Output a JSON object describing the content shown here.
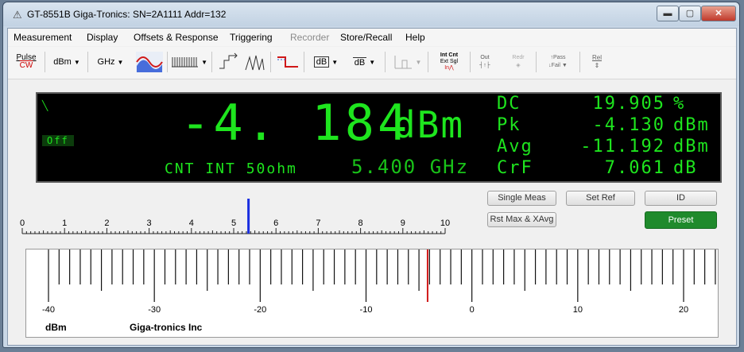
{
  "window": {
    "title": "GT-8551B Giga-Tronics: SN=2A1111  Addr=132",
    "min_glyph": "▬",
    "max_glyph": "▢",
    "close_glyph": "✕"
  },
  "menu": [
    {
      "label": "Measurement",
      "enabled": true
    },
    {
      "label": "Display",
      "enabled": true
    },
    {
      "label": "Offsets & Response",
      "enabled": true
    },
    {
      "label": "Triggering",
      "enabled": true
    },
    {
      "label": "Recorder",
      "enabled": false
    },
    {
      "label": "Store/Recall",
      "enabled": true
    },
    {
      "label": "Help",
      "enabled": true
    }
  ],
  "toolbar": {
    "pulse_label": "Pulse",
    "cw_label": "CW",
    "units_label": "dBm",
    "freq_label": "GHz",
    "dB_label": "dB",
    "int_label": "Int",
    "cnt_label": "Cnt",
    "ext_label": "Ext",
    "sgl_label": "Sgl",
    "in_label": "In",
    "out_label": "Out",
    "redr_label": "Redr",
    "pass_label": "Pass",
    "fail_label": "Fail",
    "rel_label": "Rel"
  },
  "readout": {
    "main_value": "-4. 184",
    "main_unit": "dBm",
    "off_label": "Off",
    "mode_line": "CNT INT 50ohm",
    "frequency": "5.400 GHz",
    "stats": [
      {
        "label": "DC",
        "value": "19.905",
        "unit": "%"
      },
      {
        "label": "Pk",
        "value": "-4.130",
        "unit": "dBm"
      },
      {
        "label": "Avg",
        "value": "-11.192",
        "unit": "dBm"
      },
      {
        "label": "CrF",
        "value": "7.061",
        "unit": "dB"
      }
    ]
  },
  "buttons": {
    "single_meas": "Single Meas",
    "set_ref": "Set Ref",
    "id": "ID",
    "rst_max": "Rst Max & XAvg",
    "preset": "Preset"
  },
  "top_scale": {
    "labels": [
      "0",
      "1",
      "2",
      "3",
      "4",
      "5",
      "6",
      "7",
      "8",
      "9",
      "10"
    ],
    "min": 0,
    "max": 10,
    "marker_value": 5.35,
    "marker_color": "#1a2ee0"
  },
  "bottom_scale": {
    "labels": [
      "-40",
      "-30",
      "-20",
      "-10",
      "0",
      "10",
      "20"
    ],
    "min": -40,
    "max": 23,
    "marker_value": -4.184,
    "marker_color": "#d11a1a",
    "unit": "dBm",
    "maker": "Giga-tronics Inc"
  },
  "colors": {
    "segment_green": "#1ee51e",
    "preset_green": "#1f8a2c"
  }
}
